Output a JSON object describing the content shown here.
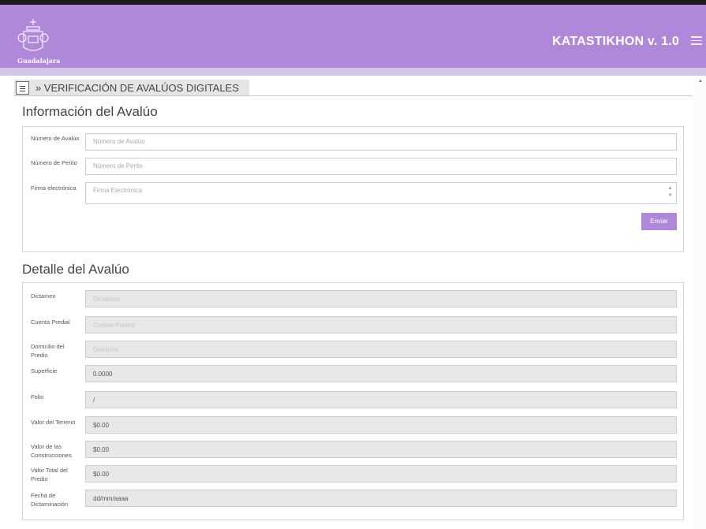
{
  "header": {
    "logo_text": "Guadalajara",
    "app_title": "KATASTIKHON   v. 1.0",
    "menu_icon": "hamburger-menu-icon"
  },
  "breadcrumb": {
    "icon": "document-icon",
    "text": "» VERIFICACIÓN DE AVALÚOS DIGITALES"
  },
  "info_section": {
    "title": "Información del Avalúo",
    "fields": [
      {
        "label": "Número de Avalúo",
        "placeholder": "Número de Avalúo",
        "value": ""
      },
      {
        "label": "Número de Perito",
        "placeholder": "Número de Perito",
        "value": ""
      },
      {
        "label": "Firma electrónica",
        "placeholder": "Firma Electrónica",
        "value": ""
      }
    ],
    "submit_label": "Enviar"
  },
  "detail_section": {
    "title": "Detalle del Avalúo",
    "fields": [
      {
        "label": "Dictamen",
        "placeholder": "Dictamen",
        "value": ""
      },
      {
        "label": "Cuenta Predial",
        "placeholder": "Cuenta Predial",
        "value": ""
      },
      {
        "label": "Domicilio del Predio",
        "placeholder": "Domicilio",
        "value": ""
      },
      {
        "label": "Superficie",
        "placeholder": "",
        "value": "0.0000"
      },
      {
        "label": "Folio",
        "placeholder": "",
        "value": "/"
      },
      {
        "label": "Valor del Terreno",
        "placeholder": "",
        "value": "$0.00"
      },
      {
        "label": "Valor de las Construcciones",
        "placeholder": "",
        "value": "$0.00"
      },
      {
        "label": "Valor Total del Predio",
        "placeholder": "",
        "value": "$0.00"
      },
      {
        "label": "Fecha de Dictaminación",
        "placeholder": "",
        "value": "dd/mm/aaaa"
      }
    ]
  },
  "colors": {
    "header_bg": "#b088d9",
    "header_strip": "#cfc6e8",
    "button_bg": "#b088d9",
    "disabled_bg": "#e8e8e8"
  }
}
